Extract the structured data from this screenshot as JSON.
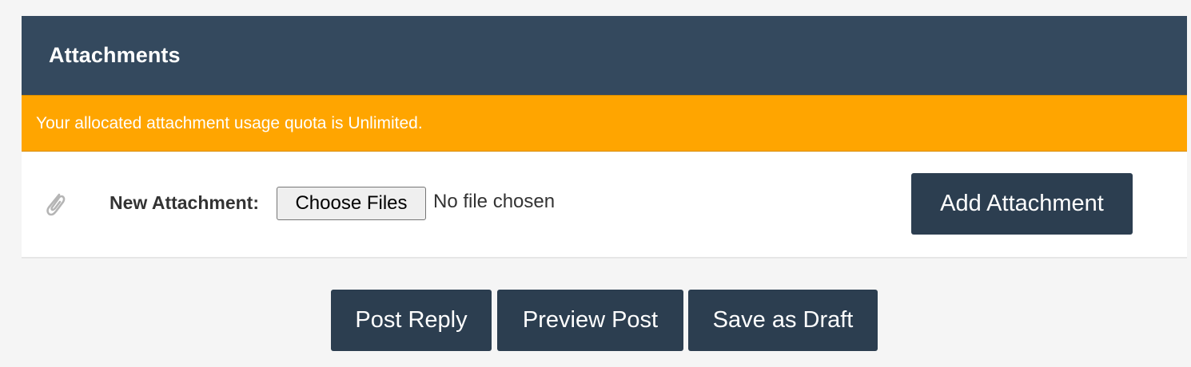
{
  "attachments": {
    "title": "Attachments",
    "quota_message": "Your allocated attachment usage quota is Unlimited.",
    "new_attachment_label": "New Attachment:",
    "choose_files_label": "Choose Files",
    "no_file_text": "No file chosen",
    "add_attachment_label": "Add Attachment",
    "icon": "paperclip-icon"
  },
  "actions": {
    "post_reply": "Post Reply",
    "preview_post": "Preview Post",
    "save_draft": "Save as Draft"
  },
  "colors": {
    "header_bg": "#34495e",
    "quota_bg": "#ffa500",
    "button_bg": "#2c3e50",
    "page_bg": "#f5f5f5"
  }
}
